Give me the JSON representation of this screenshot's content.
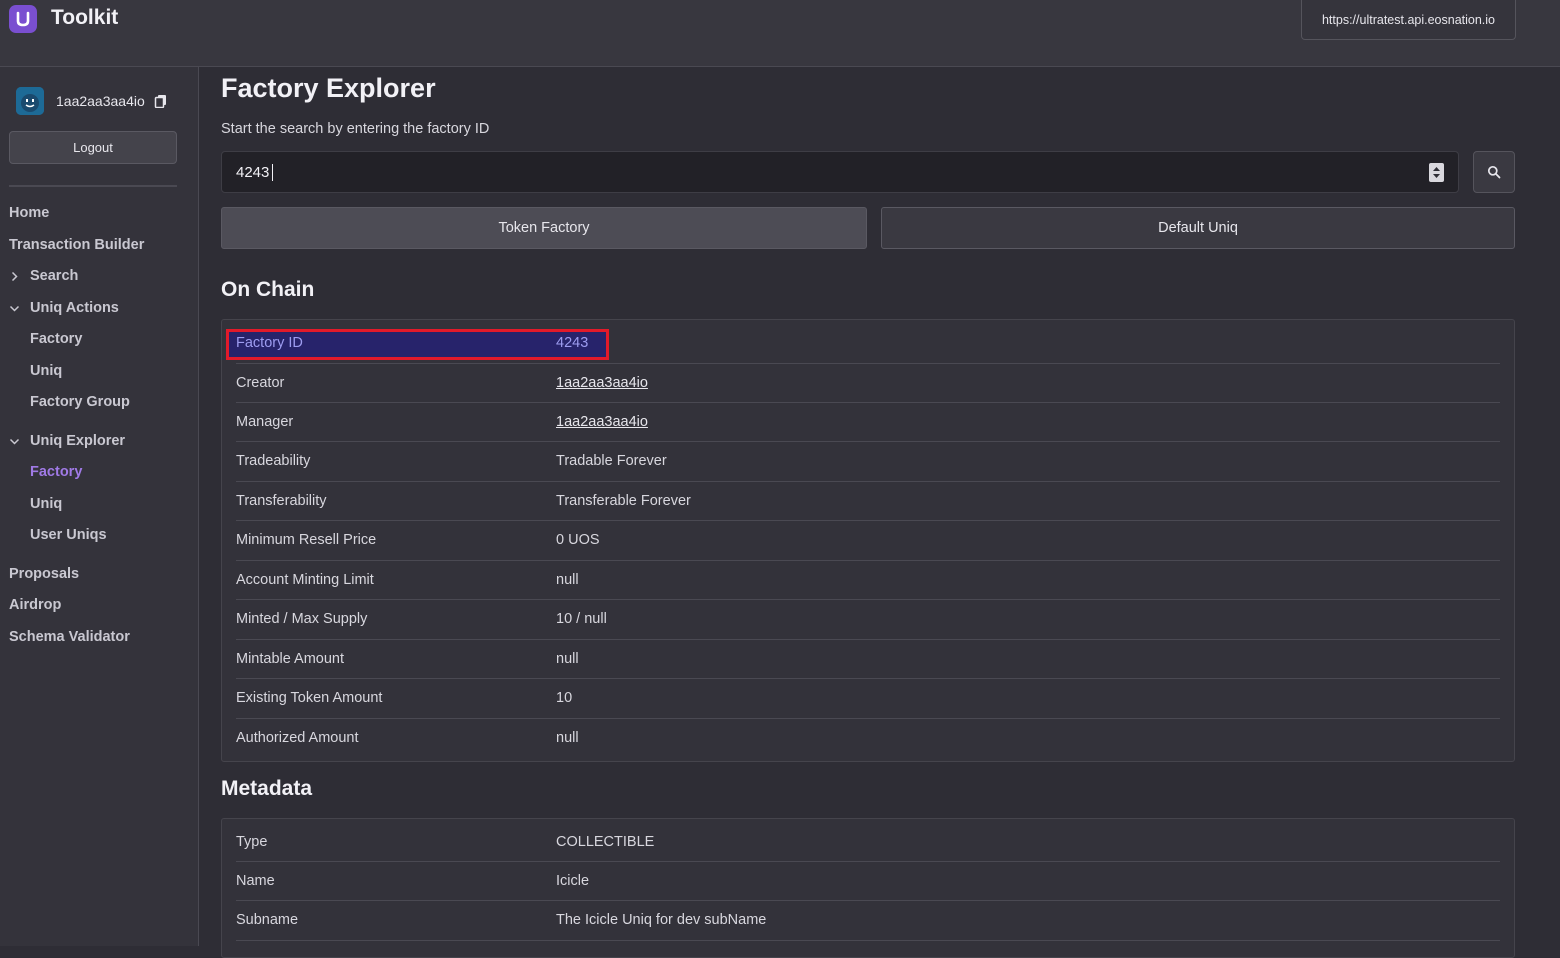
{
  "header": {
    "app_title": "Toolkit",
    "endpoint": "https://ultratest.api.eosnation.io"
  },
  "sidebar": {
    "username": "1aa2aa3aa4io",
    "logout_label": "Logout",
    "items": {
      "home": "Home",
      "transaction_builder": "Transaction Builder",
      "search": "Search",
      "uniq_actions": "Uniq Actions",
      "uniq_actions_factory": "Factory",
      "uniq_actions_uniq": "Uniq",
      "uniq_actions_factory_group": "Factory Group",
      "uniq_explorer": "Uniq Explorer",
      "uniq_explorer_factory": "Factory",
      "uniq_explorer_uniq": "Uniq",
      "uniq_explorer_user_uniqs": "User Uniqs",
      "proposals": "Proposals",
      "airdrop": "Airdrop",
      "schema_validator": "Schema Validator"
    },
    "active_item": "uniq_explorer_factory",
    "accent_color": "#a07ae6"
  },
  "main": {
    "title": "Factory Explorer",
    "subtitle": "Start the search by entering the factory ID",
    "search_value": "4243",
    "tabs": {
      "token_factory": "Token Factory",
      "default_uniq": "Default Uniq"
    },
    "selected_tab": "token_factory",
    "on_chain": {
      "title": "On Chain",
      "rows": [
        {
          "key": "Factory ID",
          "value": "4243"
        },
        {
          "key": "Creator",
          "value": "1aa2aa3aa4io"
        },
        {
          "key": "Manager",
          "value": "1aa2aa3aa4io"
        },
        {
          "key": "Tradeability",
          "value": "Tradable Forever"
        },
        {
          "key": "Transferability",
          "value": "Transferable Forever"
        },
        {
          "key": "Minimum Resell Price",
          "value": "0 UOS"
        },
        {
          "key": "Account Minting Limit",
          "value": "null"
        },
        {
          "key": "Minted / Max Supply",
          "value": "10 / null"
        },
        {
          "key": "Mintable Amount",
          "value": "null"
        },
        {
          "key": "Existing Token Amount",
          "value": "10"
        },
        {
          "key": "Authorized Amount",
          "value": "null"
        }
      ]
    },
    "metadata": {
      "title": "Metadata",
      "rows": [
        {
          "key": "Type",
          "value": "COLLECTIBLE"
        },
        {
          "key": "Name",
          "value": "Icicle"
        },
        {
          "key": "Subname",
          "value": "The Icicle Uniq for dev subName"
        }
      ]
    },
    "highlight_color": "#e21a2a"
  }
}
